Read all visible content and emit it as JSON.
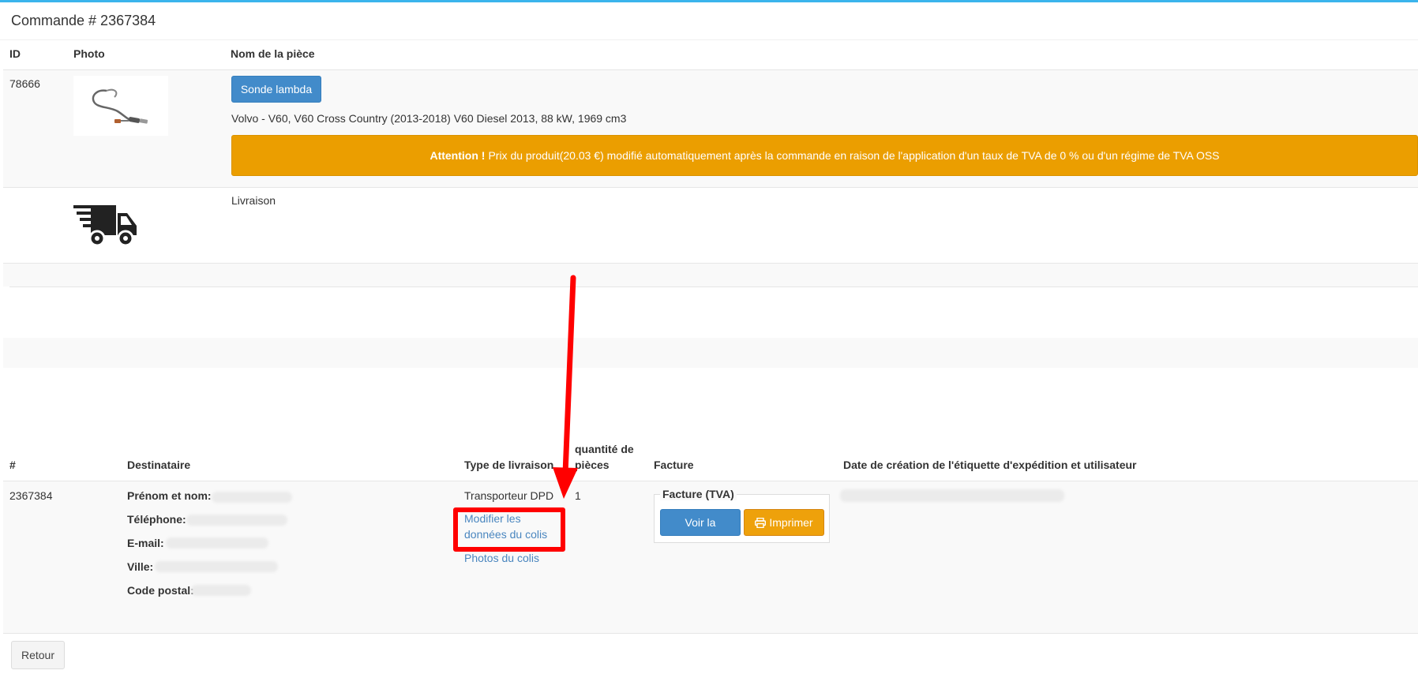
{
  "order": {
    "title": "Commande # 2367384"
  },
  "items_table": {
    "headers": {
      "id": "ID",
      "photo": "Photo",
      "name": "Nom de la pièce"
    },
    "product": {
      "id": "78666",
      "part_button": "Sonde lambda",
      "vehicle": "Volvo - V60, V60 Cross Country (2013-2018) V60 Diesel 2013, 88 kW, 1969 cm3",
      "alert_strong": "Attention !",
      "alert_text": "Prix du produit(20.03 €) modifié automatiquement après la commande en raison de l'application d'un taux de TVA de 0 % ou d'un régime de TVA OSS"
    },
    "delivery": {
      "label": "Livraison"
    }
  },
  "shipment_table": {
    "headers": {
      "num": "#",
      "recipient": "Destinataire",
      "delivery_type": "Type de livraison",
      "quantity_line1": "quantité de",
      "quantity_line2": "pièces",
      "invoice": "Facture",
      "label_date": "Date de création de l'étiquette d'expédition et utilisateur"
    },
    "row": {
      "num": "2367384",
      "fields": {
        "name": "Prénom et nom:",
        "phone": "Téléphone:",
        "email": "E-mail:",
        "city": "Ville:",
        "postal": "Code postal:"
      },
      "carrier": "Transporteur DPD",
      "edit_link_line1": "Modifier les",
      "edit_link_line2": "données du colis",
      "photos_link": "Photos du colis",
      "quantity": "1",
      "invoice_legend": "Facture (TVA)",
      "view_button": "Voir la",
      "print_button": "Imprimer"
    }
  },
  "back_button": "Retour",
  "colors": {
    "accent": "#3bb4ec",
    "primary": "#428bca",
    "warning": "#eb9e00",
    "annotation": "#ff0000"
  }
}
